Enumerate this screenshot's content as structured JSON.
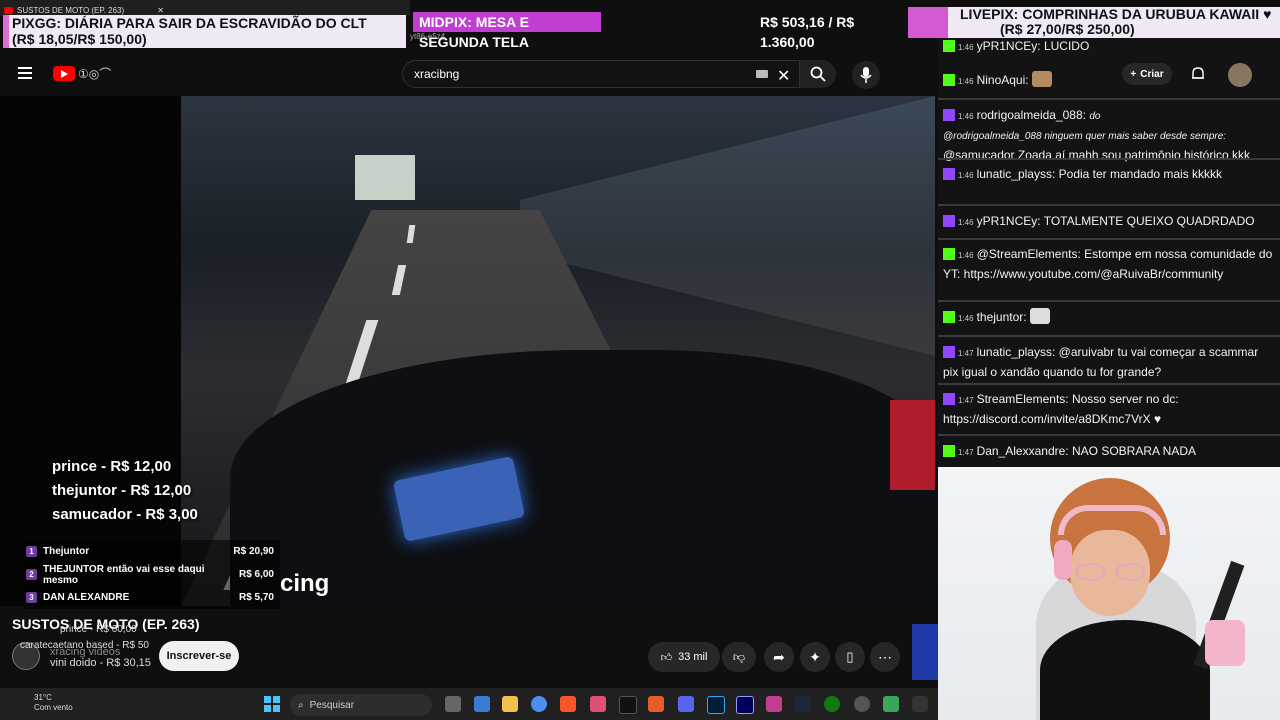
{
  "browser": {
    "tab_title": "SUSTOS DE MOTO (EP. 263)",
    "url_fragment": "yt86-e5z4"
  },
  "alerts": {
    "pixgg_line1": "PIXGG: DIÁRIA PARA SAIR DA ESCRAVIDÃO DO CLT",
    "pixgg_line2": "(R$ 18,05/R$ 150,00)",
    "midpix_label": "MIDPIX: MESA E SEGUNDA TELA",
    "midpix_value": "R$ 503,16 / R$ 1.360,00",
    "livepix_line1": "LIVEPIX: COMPRINHAS DA URUBUA KAWAII ♥",
    "livepix_line2": "(R$ 27,00/R$ 250,00)"
  },
  "youtube": {
    "search_value": "xracibng",
    "create_label": "Criar",
    "video_title": "SUSTOS DE MOTO (EP. 263)",
    "channel_name": "xracing videos",
    "subscribe_label": "Inscrever-se",
    "like_count": "33 mil",
    "watermark": "cing"
  },
  "overlay": {
    "donors": [
      {
        "text": "prince - R$ 12,00"
      },
      {
        "text": "thejuntor - R$ 12,00"
      },
      {
        "text": "samucador - R$ 3,00"
      }
    ],
    "ranking": [
      {
        "num": "1",
        "name": "Thejuntor",
        "value": "R$ 20,90"
      },
      {
        "num": "2",
        "name": "THEJUNTOR então vai esse daqui mesmo",
        "value": "R$ 6,00"
      },
      {
        "num": "3",
        "name": "DAN ALEXANDRE",
        "value": "R$ 5,70"
      }
    ],
    "ghost_lines": [
      "prince - R$ 60,00",
      "caratecaetano based - R$ 50",
      "vini doido - R$ 30,15"
    ]
  },
  "taskbar": {
    "temperature": "31°C",
    "weather": "Com vento",
    "search_placeholder": "Pesquisar"
  },
  "chat": [
    {
      "time": "1:46",
      "user": "yPR1NCEy:",
      "text": "LUCIDO",
      "platform": "kick"
    },
    {
      "time": "1:46",
      "user": "NinoAqui:",
      "text": "",
      "platform": "kick"
    },
    {
      "time": "1:46",
      "user": "rodrigoalmeida_088:",
      "text": "do",
      "quote": "@rodrigoalmeida_088 ninguem quer mais saber desde sempre:",
      "extra": "@samucador Zoada aí mahh sou patrimônio histórico kkk",
      "platform": "twitch"
    },
    {
      "time": "1:46",
      "user": "lunatic_playss:",
      "text": "Podia ter mandado mais kkkkk",
      "platform": "twitch"
    },
    {
      "time": "1:46",
      "user": "yPR1NCEy:",
      "text": "TOTALMENTE QUEIXO QUADRDADO",
      "platform": "kick"
    },
    {
      "time": "1:46",
      "user": "@StreamElements:",
      "text": "Estompe em nossa comunidade do YT: https://www.youtube.com/@aRuivaBr/community",
      "platform": "kick"
    },
    {
      "time": "1:46",
      "user": "thejuntor:",
      "text": "",
      "platform": "kick"
    },
    {
      "time": "1:47",
      "user": "lunatic_playss:",
      "text": "@aruivabr tu vai começar a scammar pix igual o xandão quando tu for grande?",
      "platform": "twitch"
    },
    {
      "time": "1:47",
      "user": "StreamElements:",
      "text": "Nosso server no dc: https://discord.com/invite/a8DKmc7VrX ♥",
      "platform": "twitch"
    },
    {
      "time": "1:47",
      "user": "Dan_Alexxandre:",
      "text": "NAO SOBRARA NADA",
      "platform": "kick"
    }
  ],
  "colors": {
    "kick": "#53fc18",
    "twitch": "#9146ff",
    "youtube": "#ff0000",
    "pix_accent": "#d35ad3"
  }
}
